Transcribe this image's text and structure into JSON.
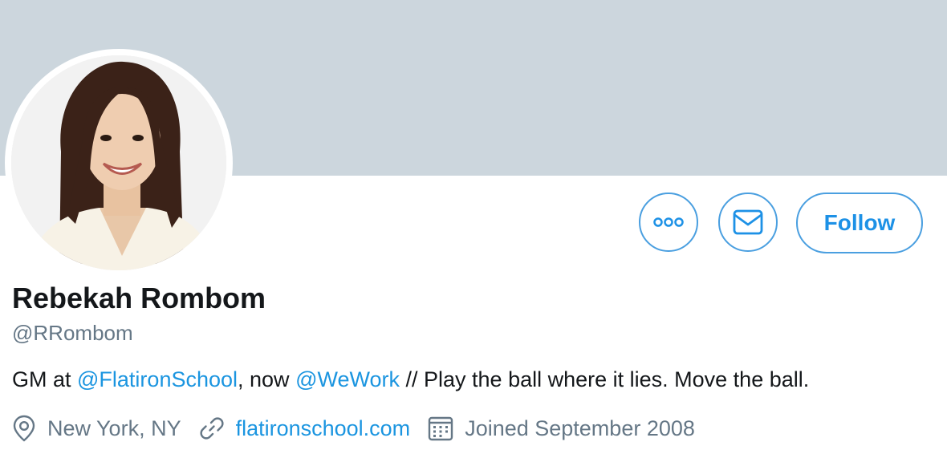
{
  "profile": {
    "name": "Rebekah Rombom",
    "handle": "@RRombom",
    "bio": {
      "part1": "GM at ",
      "mention1": "@FlatironSchool",
      "part2": ", now ",
      "mention2": "@WeWork",
      "part3": " // Play the ball where it lies. Move the ball."
    },
    "location": "New York, NY",
    "website": "flatironschool.com",
    "joined": "Joined September 2008"
  },
  "actions": {
    "more_icon": "more-horizontal-icon",
    "message_icon": "envelope-icon",
    "follow_label": "Follow"
  },
  "icons": {
    "location": "location-pin-icon",
    "link": "link-icon",
    "calendar": "calendar-icon"
  },
  "colors": {
    "banner": "#ccd6dd",
    "accent": "#1b95e0",
    "button_border": "#4a9fe0",
    "secondary_text": "#657786",
    "primary_text": "#14171a"
  }
}
